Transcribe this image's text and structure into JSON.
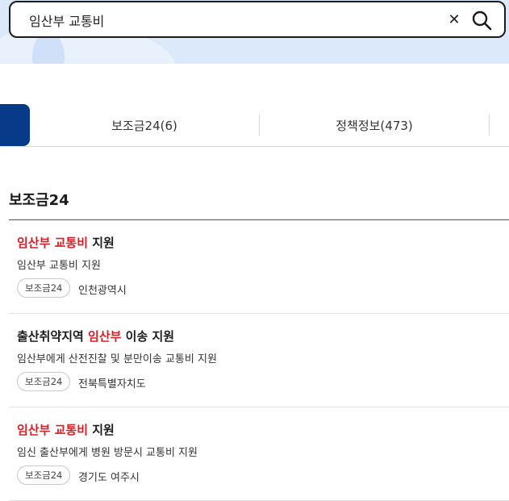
{
  "search": {
    "value": "임산부 교통비"
  },
  "tabs": [
    {
      "label": "보조금24(6)"
    },
    {
      "label": "정책정보(473)"
    }
  ],
  "section": {
    "title": "보조금24"
  },
  "results": [
    {
      "title_parts": [
        {
          "text": "임산부 교통비",
          "highlight": true
        },
        {
          "text": " 지원",
          "highlight": false
        }
      ],
      "description": "임산부 교통비 지원",
      "badge": "보조금24",
      "region": "인천광역시"
    },
    {
      "title_parts": [
        {
          "text": "출산취약지역 ",
          "highlight": false
        },
        {
          "text": "임산부",
          "highlight": true
        },
        {
          "text": " 이송 지원",
          "highlight": false
        }
      ],
      "description": "임산부에게 산전진찰 및 분만이송 교통비 지원",
      "badge": "보조금24",
      "region": "전북특별자치도"
    },
    {
      "title_parts": [
        {
          "text": "임산부 교통비",
          "highlight": true
        },
        {
          "text": " 지원",
          "highlight": false
        }
      ],
      "description": "임신 출산부에게 병원 방문시 교통비 지원",
      "badge": "보조금24",
      "region": "경기도 여주시"
    }
  ],
  "colors": {
    "highlight": "#d61f26",
    "tab_active": "#083a8a",
    "header_band": "#dce9fb"
  },
  "icons": {
    "clear": "close-icon",
    "search": "search-icon"
  }
}
